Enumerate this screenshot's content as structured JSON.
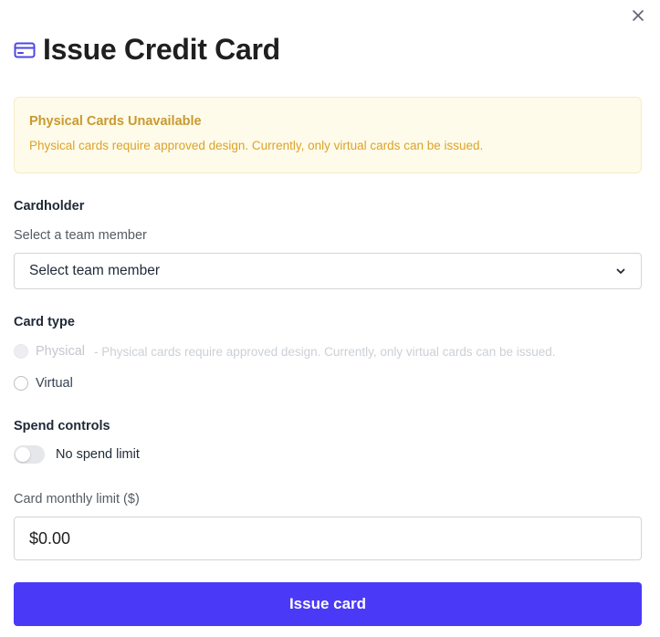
{
  "dialog": {
    "title": "Issue Credit Card",
    "header_icon": "credit-card-icon",
    "close_icon": "close-icon"
  },
  "alert": {
    "title": "Physical Cards Unavailable",
    "message": "Physical cards require approved design. Currently, only virtual cards can be issued."
  },
  "cardholder": {
    "label": "Cardholder",
    "sublabel": "Select a team member",
    "selected_value": "Select team member"
  },
  "card_type": {
    "label": "Card type",
    "options": [
      {
        "label": "Physical",
        "description": "- Physical cards require approved design. Currently, only virtual cards can be issued.",
        "disabled": true,
        "selected": false
      },
      {
        "label": "Virtual",
        "description": "",
        "disabled": false,
        "selected": false
      }
    ]
  },
  "spend_controls": {
    "label": "Spend controls",
    "toggle_label": "No spend limit",
    "toggle_on": false
  },
  "monthly_limit": {
    "label": "Card monthly limit ($)",
    "value": "$0.00"
  },
  "submit": {
    "label": "Issue card"
  },
  "colors": {
    "primary": "#4a3af7",
    "alert_bg": "#fefbea",
    "alert_text": "#dca32a",
    "icon_accent": "#4f46e5"
  }
}
